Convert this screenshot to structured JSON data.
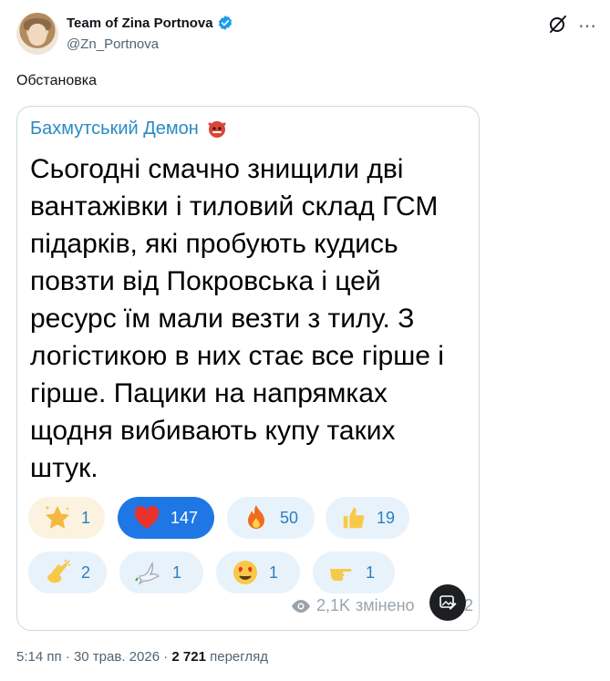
{
  "author": {
    "name": "Team of Zina Portnova",
    "handle": "@Zn_Portnova"
  },
  "tweet": {
    "text": "Обстановка"
  },
  "embed": {
    "channel": "Бахмутський Демон",
    "post_text": "Сьогодні смачно знищили дві\nвантажівки і тиловий склад ГСМ\nпідарків, які пробують кудись\nповзти від Покровська і цей\nресурс їм мали везти з тилу. З\nлогістикою в них стає все гірше і\nгірше. Пацики на напрямках\nщодня вибивають купу таких\nштук.",
    "reactions": [
      {
        "icon": "star-icon",
        "count": "1"
      },
      {
        "icon": "heart-icon",
        "count": "147"
      },
      {
        "icon": "fire-icon",
        "count": "50"
      },
      {
        "icon": "thumbs-up-icon",
        "count": "19"
      },
      {
        "icon": "clap-icon",
        "count": "2"
      },
      {
        "icon": "dove-icon",
        "count": "1"
      },
      {
        "icon": "heart-eyes-icon",
        "count": "1"
      },
      {
        "icon": "pointing-hand-icon",
        "count": "1"
      }
    ],
    "views": "2,1K",
    "edited_label": "змінено",
    "trail": "2"
  },
  "footer": {
    "time": "5:14 пп",
    "separator": "·",
    "date": "30 трав. 2026",
    "views_count": "2 721",
    "views_label": "перегляд"
  },
  "colors": {
    "accent": "#1d9bf0",
    "channel": "#2a8bc2",
    "reaction_selected": "#1f77e6",
    "reaction_bg": "#e8f2fb"
  }
}
